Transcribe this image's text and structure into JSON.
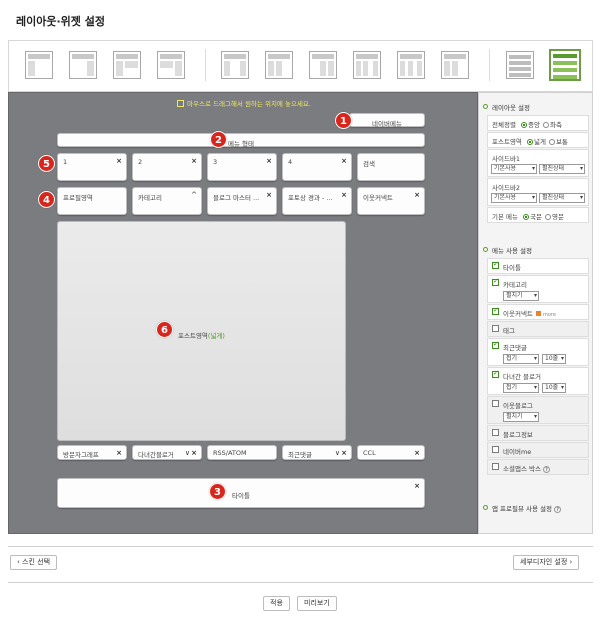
{
  "page_title": "레이아웃·위젯 설정",
  "canvas": {
    "hint": "마우스로 드래그해서 원하는 위치에 놓으세요.",
    "nav_menu": "네이버메뉴",
    "menu_form": "메뉴 형태",
    "slots": [
      "1",
      "2",
      "3",
      "4",
      "검색"
    ],
    "widgets_row2": [
      "프로필영역",
      "카테고리",
      "블로그 마스터 ...",
      "포토상 경과 - ...",
      "이웃커넥트"
    ],
    "post_area": "포스트영역",
    "post_area_accent": "(넓게)",
    "widgets_bottom": [
      "방문자그래프",
      "다녀간블로거",
      "RSS/ATOM",
      "최근댓글",
      "CCL"
    ],
    "title_area": "타이틀",
    "badges": [
      "1",
      "2",
      "3",
      "4",
      "5",
      "6"
    ],
    "close_glyph": "×",
    "collapse_glyph": "^",
    "dropdown_glyph": "∨"
  },
  "side": {
    "layout_title": "레이아웃 설정",
    "align_label": "전체정렬",
    "align_opts": [
      "중앙",
      "좌측"
    ],
    "post_label": "포스트영역",
    "post_opts": [
      "넓게",
      "보통"
    ],
    "sidebar1_label": "사이드바1",
    "sidebar2_label": "사이드바2",
    "sidebar_sel_a": "기본사용",
    "sidebar_sel_b": "펼친상태",
    "basic_menu_label": "기본 메뉴",
    "basic_menu_opts": [
      "국문",
      "영문"
    ],
    "menu_title": "메뉴 사용 설정",
    "menu_items": {
      "title": "타이틀",
      "category": "카테고리",
      "category_sel": "펼치기",
      "neighbor": "이웃커넥트",
      "neighbor_extra": "more",
      "tag": "태그",
      "recent_comment": "최근댓글",
      "recent_comment_sel_a": "접기",
      "recent_comment_sel_b": "10줄",
      "visited": "다녀간 블로거",
      "visited_sel_a": "접기",
      "visited_sel_b": "10줄",
      "neighbor_blog": "이웃블로그",
      "neighbor_blog_sel": "펼치기",
      "blog_info": "블로그정보",
      "naver_me": "네이버me",
      "social_app": "소셜앱스 박스",
      "help": "?"
    },
    "app_title": "앱 프로필뷰 사용 설정",
    "app_help": "?"
  },
  "footer": {
    "skin_select": "스킨 선택",
    "detail_design": "세부디자인 설정",
    "apply": "적용",
    "preview": "미리보기",
    "prev_arrow": "‹",
    "next_arrow": "›"
  },
  "colors": {
    "canvas_bg": "#7b7c80",
    "badge": "#d9261c",
    "accent_green": "#3b8d1c",
    "hint_yellow": "#f2e75a"
  }
}
